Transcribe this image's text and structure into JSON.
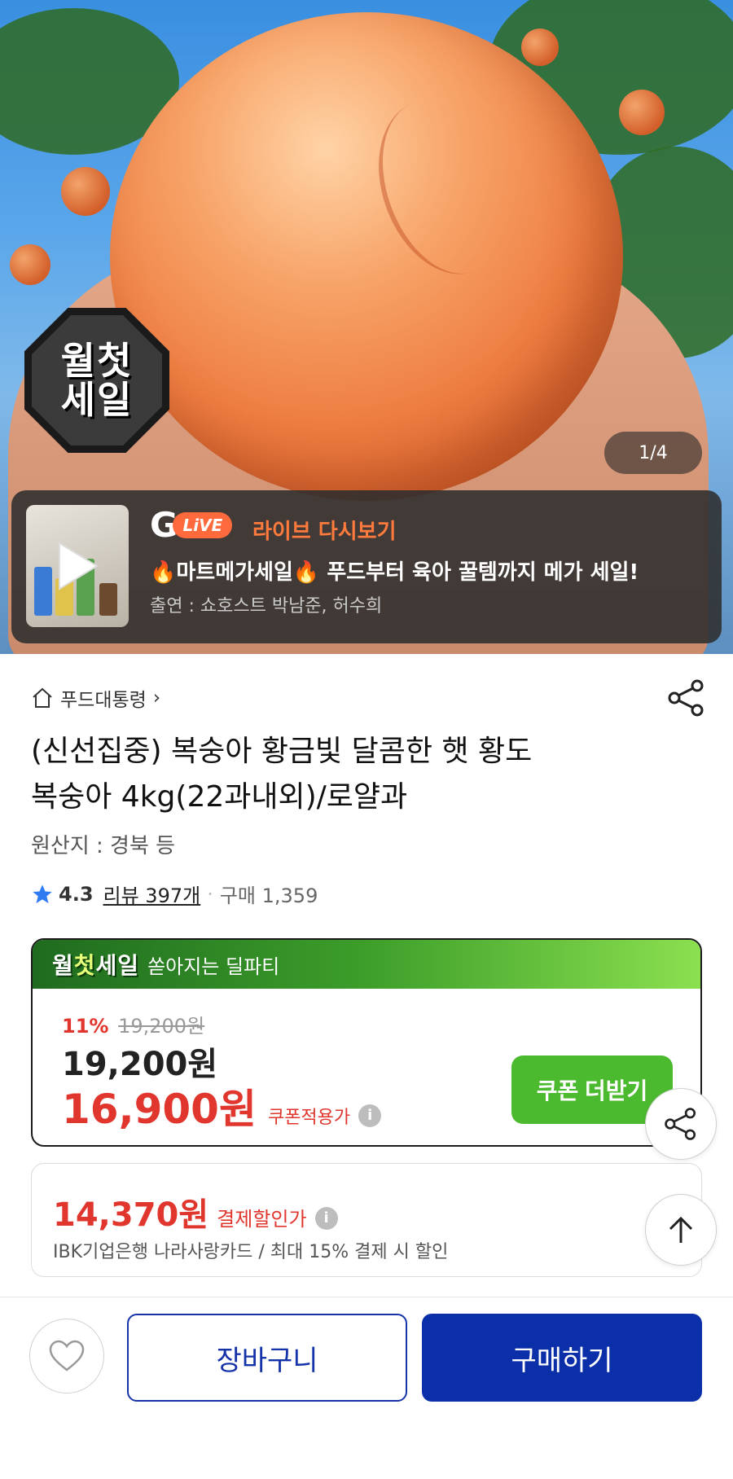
{
  "hero": {
    "badge_line1": "월첫",
    "badge_line2": "세일",
    "image_counter": "1/4"
  },
  "live": {
    "logo_g": "G",
    "logo_pill": "LiVE",
    "replay_label": "라이브 다시보기",
    "title": "🔥마트메가세일🔥 푸드부터 육아 꿀템까지 메가 세일!",
    "cast": "출연 : 쇼호스트 박남준, 허수희"
  },
  "breadcrumb": {
    "category": "푸드대통령",
    "chevron": "›"
  },
  "product": {
    "title_line1": "(신선집중) 복숭아 황금빛 달콤한 햇 황도",
    "title_line2": "복숭아 4kg(22과내외)/로얄과",
    "origin": "원산지 : 경북  등",
    "rating_score": "4.3",
    "review_text": "리뷰 397개",
    "dot": "·",
    "purchase_text": "구매 1,359"
  },
  "sale_box": {
    "brand_a": "월",
    "brand_b": "첫",
    "brand_c": "세일",
    "subtitle": "쏟아지는 딜파티",
    "discount_rate": "11%",
    "original_price": "19,200원",
    "price": "19,200원",
    "coupon_price": "16,900원",
    "coupon_tag": "쿠폰적용가",
    "coupon_button": "쿠폰 더받기"
  },
  "payment": {
    "price": "14,370원",
    "tag": "결제할인가",
    "description": "IBK기업은행 나라사랑카드 / 최대 15% 결제 시 할인"
  },
  "bottom_bar": {
    "cart_label": "장바구니",
    "buy_label": "구매하기"
  },
  "icons": {
    "home": "home-icon",
    "share": "share-icon",
    "star": "star-icon",
    "info": "info-icon",
    "arrow_up": "arrow-up-icon",
    "heart": "heart-icon",
    "play": "play-icon"
  },
  "colors": {
    "accent_red": "#e0362e",
    "primary_blue": "#0b2fa8",
    "coupon_green": "#4cba2f",
    "live_orange": "#ff7a3d",
    "star_blue": "#2f7bf0"
  }
}
